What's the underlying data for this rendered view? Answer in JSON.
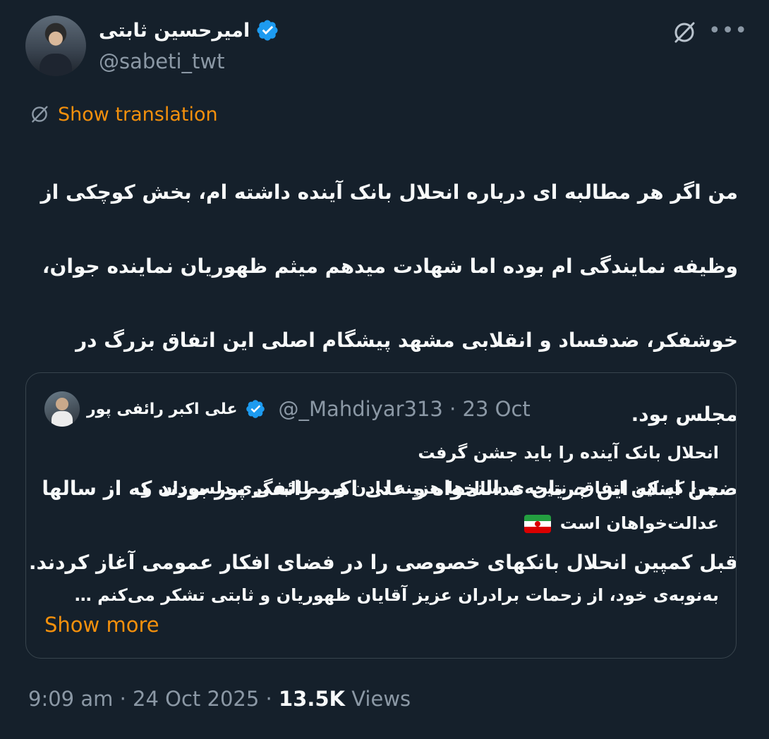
{
  "tweet": {
    "author": {
      "display_name": "امیرحسین ثابتی",
      "handle": "@sabeti_twt",
      "verified": true
    },
    "translate_label": "Show translation",
    "text_lines": [
      "من اگر هر مطالبه ای درباره انحلال بانک آینده داشته ام، بخش کوچکی از",
      "وظیفه نمایندگی ام بوده اما شهادت میدهم میثم ظهوریان نماینده جوان،",
      "خوشفکر، ضدفساد و انقلابی مشهد پیشگام اصلی این اتفاق بزرگ در",
      "مجلس بود.",
      "ضمن اینکه این جریان عدالتخواه و علی اکبر رائفی پور بودند که از سالها",
      "قبل کمپین انحلال بانکهای خصوصی را در فضای افکار عمومی آغاز کردند."
    ],
    "quote": {
      "author_name": "علی اکبر رائفی پور",
      "handle": "@_Mahdiyar313",
      "separator": "·",
      "date": "23 Oct",
      "lines": [
        "انحلال بانک آینده را باید جشن گرفت",
        "چرا که این اتفاق، نتیجه‌ی سال‌ها هزینه دادن و مطالبه‌گری دلسوزان و",
        "عدالت‌خواهان است",
        "به‌نوبه‌ی خود، از زحمات برادران عزیز آقایان ظهوریان و ثابتی تشکر می‌کنم …"
      ],
      "show_more": "Show more"
    },
    "footer": {
      "time": "9:09 am",
      "sep1": "·",
      "date": "24 Oct 2025",
      "sep2": "·",
      "views_count": "13.5K",
      "views_label": "Views"
    }
  },
  "colors": {
    "background": "#15202b",
    "accent": "#f4900c",
    "verified": "#1d9bf0",
    "muted": "#8b98a5",
    "border": "#38444d"
  },
  "icons": {
    "grok": "grok-icon",
    "more": "more-options-icon",
    "translate": "translate-icon",
    "verified": "verified-badge-icon",
    "flag": "iran-flag-emoji"
  }
}
